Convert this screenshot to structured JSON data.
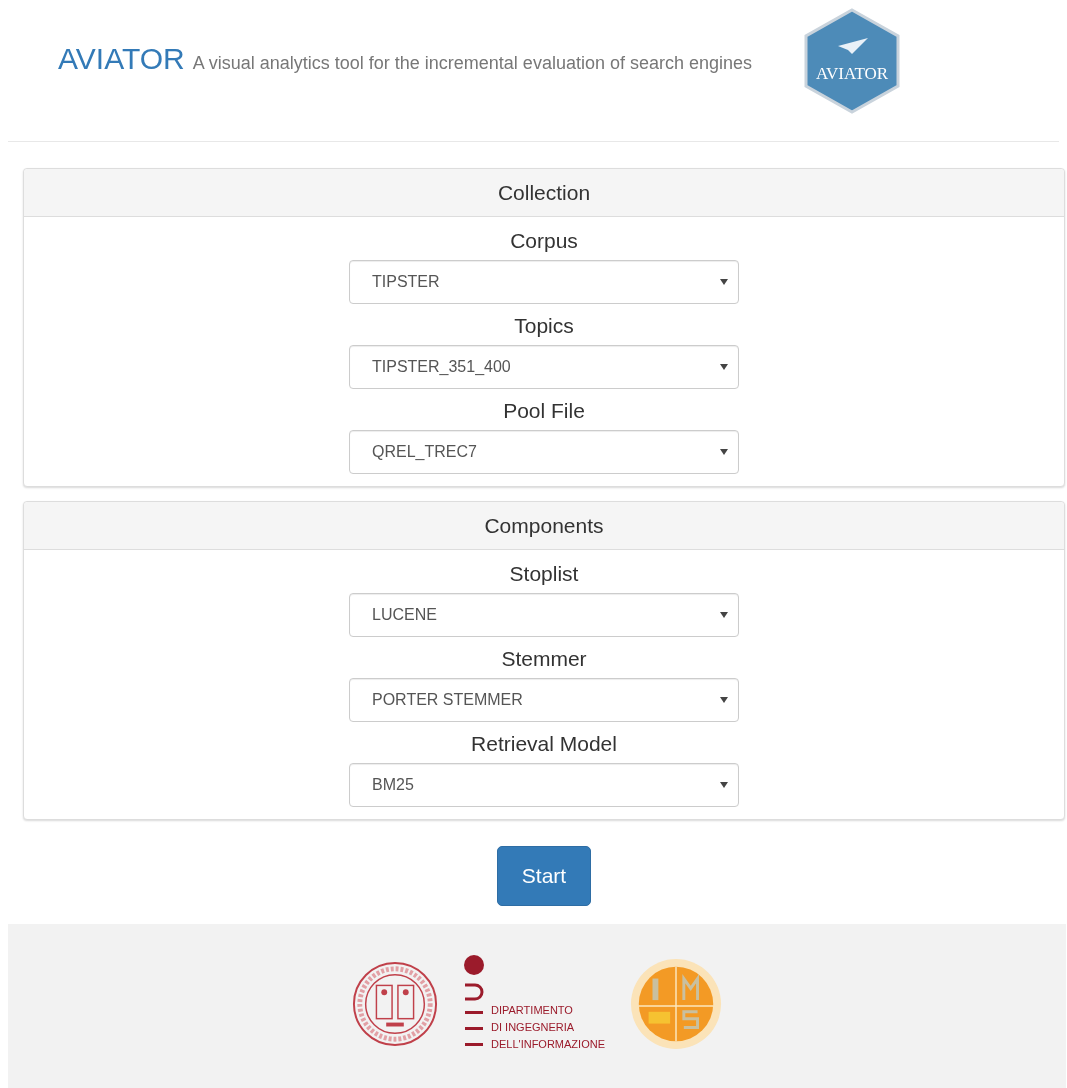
{
  "header": {
    "title": "AVIATOR",
    "subtitle": "A visual analytics tool for the incremental evaluation of search engines",
    "logo_text": "AVIATOR"
  },
  "panels": [
    {
      "title": "Collection",
      "fields": [
        {
          "label": "Corpus",
          "value": "TIPSTER"
        },
        {
          "label": "Topics",
          "value": "TIPSTER_351_400"
        },
        {
          "label": "Pool File",
          "value": "QREL_TREC7"
        }
      ]
    },
    {
      "title": "Components",
      "fields": [
        {
          "label": "Stoplist",
          "value": "LUCENE"
        },
        {
          "label": "Stemmer",
          "value": "PORTER STEMMER"
        },
        {
          "label": "Retrieval Model",
          "value": "BM25"
        }
      ]
    }
  ],
  "start_button": "Start",
  "footer": {
    "department_lines": [
      "DIPARTIMENTO",
      "DI INGEGNERIA",
      "DELL'INFORMAZIONE"
    ]
  }
}
